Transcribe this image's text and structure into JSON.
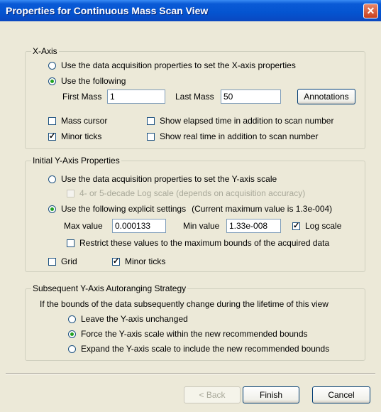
{
  "window": {
    "title": "Properties for Continuous Mass Scan View",
    "close_glyph": "✕"
  },
  "x_axis": {
    "legend": "X-Axis",
    "opt_acq_label": "Use the data acquisition properties to set the X-axis properties",
    "opt_following_label": "Use the following",
    "selected": "following",
    "first_mass_label": "First Mass",
    "first_mass_value": "1",
    "last_mass_label": "Last Mass",
    "last_mass_value": "50",
    "annotations_label": "Annotations",
    "mass_cursor_label": "Mass cursor",
    "mass_cursor_checked": false,
    "elapsed_time_label": "Show elapsed time in addition to scan number",
    "elapsed_time_checked": false,
    "minor_ticks_label": "Minor ticks",
    "minor_ticks_checked": true,
    "real_time_label": "Show real time in addition to scan number",
    "real_time_checked": false
  },
  "y_axis": {
    "legend": "Initial Y-Axis Properties",
    "opt_acq_label": "Use the data acquisition properties to set the Y-axis scale",
    "log_decade_label": "4- or 5-decade Log scale (depends on acquisition accuracy)",
    "opt_explicit_label": "Use the following explicit settings",
    "current_max_note": "(Current maximum value is 1.3e-004)",
    "selected": "explicit",
    "max_label": "Max value",
    "max_value": "0.000133",
    "min_label": "Min value",
    "min_value": "1.33e-008",
    "log_scale_label": "Log scale",
    "log_scale_checked": true,
    "restrict_label": "Restrict these values to the maximum bounds of the acquired data",
    "restrict_checked": false,
    "grid_label": "Grid",
    "grid_checked": false,
    "minor_ticks_label": "Minor ticks",
    "minor_ticks_checked": true
  },
  "autorange": {
    "legend": "Subsequent Y-Axis Autoranging Strategy",
    "intro": "If the bounds of the data subsequently change during the lifetime of this view",
    "opt_leave": "Leave the Y-axis unchanged",
    "opt_force": "Force the Y-axis scale within the new recommended bounds",
    "opt_expand": "Expand the Y-axis scale to include the new recommended bounds",
    "selected": "force"
  },
  "footer": {
    "back_label": "< Back",
    "finish_label": "Finish",
    "cancel_label": "Cancel"
  },
  "colors": {
    "titlebar": "#0454d0",
    "dialog_bg": "#ece9d8",
    "radio_dot": "#21a121",
    "close_button": "#c8401e"
  }
}
